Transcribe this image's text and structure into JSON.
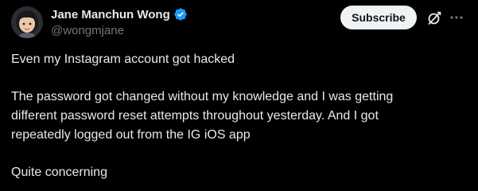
{
  "author": {
    "display_name": "Jane Manchun Wong",
    "handle": "@wongmjane",
    "verified": true,
    "verified_color": "#1d9bf0"
  },
  "actions": {
    "subscribe_label": "Subscribe",
    "grok_icon": "grok-slash-icon",
    "more_icon": "more-dots-icon"
  },
  "tweet": {
    "paragraph_1": "Even my Instagram account got hacked",
    "paragraph_2_line_1": "The password got changed without my knowledge and I was getting",
    "paragraph_2_line_2": "different password reset attempts throughout yesterday. And I got",
    "paragraph_2_line_3": "repeatedly logged out from the IG iOS app",
    "paragraph_3": "Quite concerning"
  },
  "colors": {
    "background": "#000000",
    "text_primary": "#e7e9ea",
    "text_secondary": "#71767b",
    "button_bg": "#eff3f4"
  }
}
